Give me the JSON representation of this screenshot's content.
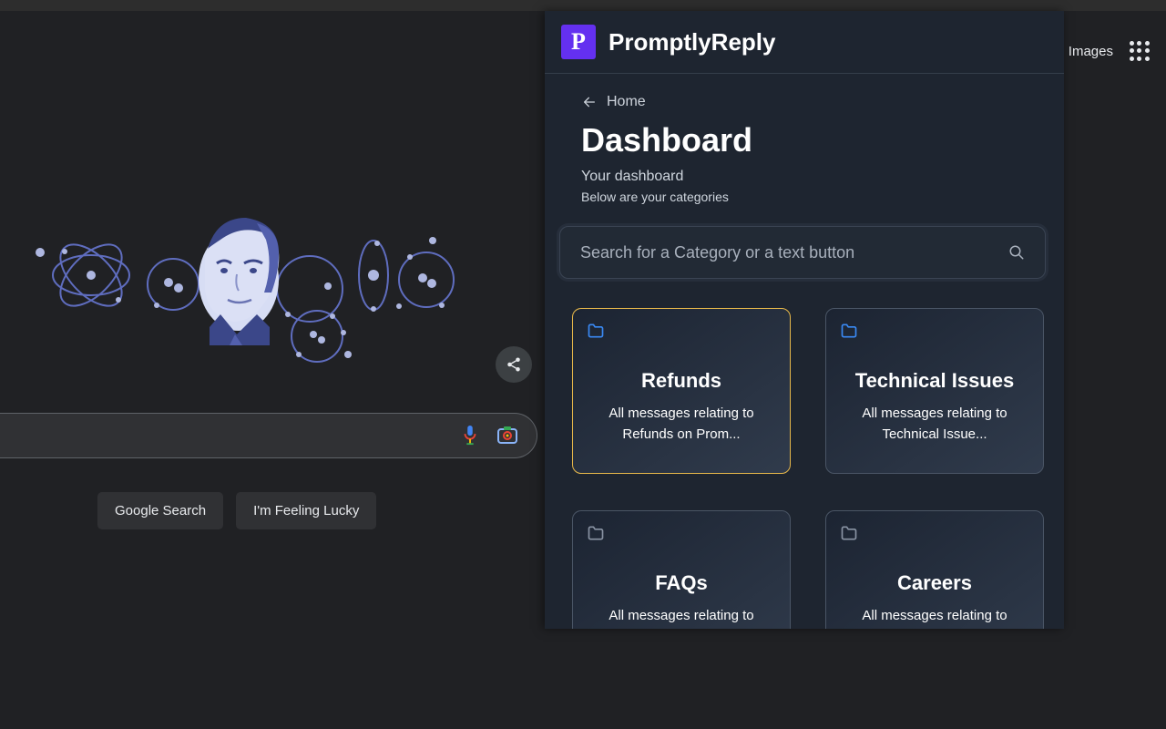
{
  "topnav": {
    "images_link": "Images"
  },
  "google": {
    "search_label": "Google Search",
    "lucky_label": "I'm Feeling Lucky"
  },
  "panel": {
    "logo_letter": "P",
    "app_name": "PromptlyReply",
    "breadcrumb_label": "Home",
    "page_title": "Dashboard",
    "subtitle": "Your dashboard",
    "subcaption": "Below are your categories",
    "search_placeholder": "Search for a Category or a text button",
    "cards": [
      {
        "title": "Refunds",
        "desc": "All messages relating to Refunds on Prom...",
        "selected": true,
        "icon_color": "blue"
      },
      {
        "title": "Technical Issues",
        "desc": "All messages relating to Technical Issue...",
        "selected": false,
        "icon_color": "blue"
      },
      {
        "title": "FAQs",
        "desc": "All messages relating to Frequently Aske...",
        "selected": false,
        "icon_color": "gray"
      },
      {
        "title": "Careers",
        "desc": "All messages relating to Careers on Prom...",
        "selected": false,
        "icon_color": "gray"
      }
    ]
  }
}
